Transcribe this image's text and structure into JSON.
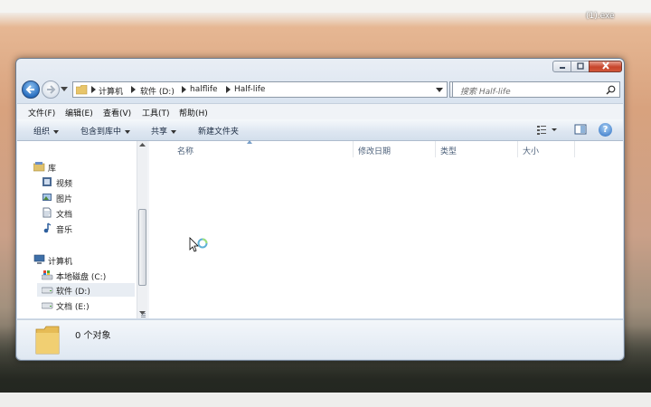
{
  "desktop": {
    "file_label": "(1).exe"
  },
  "address": {
    "crumbs": [
      "计算机",
      "软件 (D:)",
      "halflife",
      "Half-life"
    ]
  },
  "search": {
    "placeholder": "搜索 Half-life"
  },
  "menu": [
    "文件(F)",
    "编辑(E)",
    "查看(V)",
    "工具(T)",
    "帮助(H)"
  ],
  "commands": {
    "organize": "组织",
    "include_in_library": "包含到库中",
    "share": "共享",
    "new_folder": "新建文件夹"
  },
  "nav_tree": {
    "libraries": "库",
    "videos": "视频",
    "pictures": "图片",
    "documents": "文档",
    "music": "音乐",
    "computer": "计算机",
    "local_disk_c": "本地磁盘 (C:)",
    "software_d": "软件 (D:)",
    "docs_e": "文档 (E:)"
  },
  "columns": [
    "名称",
    "修改日期",
    "类型",
    "大小"
  ],
  "status": {
    "item_count": "0 个对象"
  },
  "icons": [
    "back-icon",
    "forward-icon",
    "folder-icon",
    "refresh-icon",
    "search-icon",
    "help-icon",
    "view-icon",
    "preview-pane-icon",
    "drive-icon",
    "library-icon",
    "computer-icon"
  ]
}
